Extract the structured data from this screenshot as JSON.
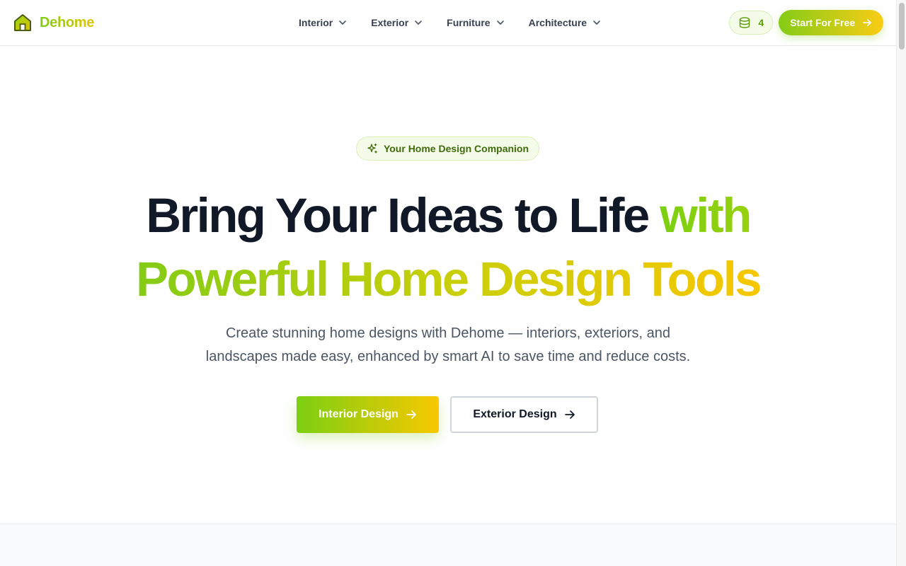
{
  "brand": {
    "name": "Dehome",
    "logo_icon": "house-icon"
  },
  "nav": {
    "items": [
      {
        "label": "Interior"
      },
      {
        "label": "Exterior"
      },
      {
        "label": "Furniture"
      },
      {
        "label": "Architecture"
      }
    ]
  },
  "header": {
    "credits": "4",
    "credits_icon": "coins-icon",
    "start_label": "Start For Free"
  },
  "hero": {
    "badge": "Your Home Design Companion",
    "headline_part1": "Bring Your Ideas to Life ",
    "headline_accent": "with",
    "headline_line2": "Powerful Home Design Tools",
    "subtitle": "Create stunning home designs with Dehome — interiors, exteriors, and landscapes made easy, enhanced by smart AI to save time and reduce costs.",
    "cta_primary": "Interior Design",
    "cta_secondary": "Exterior Design"
  },
  "colors": {
    "accent_green": "#84cc16",
    "accent_yellow": "#facc15",
    "text_dark": "#111827"
  }
}
